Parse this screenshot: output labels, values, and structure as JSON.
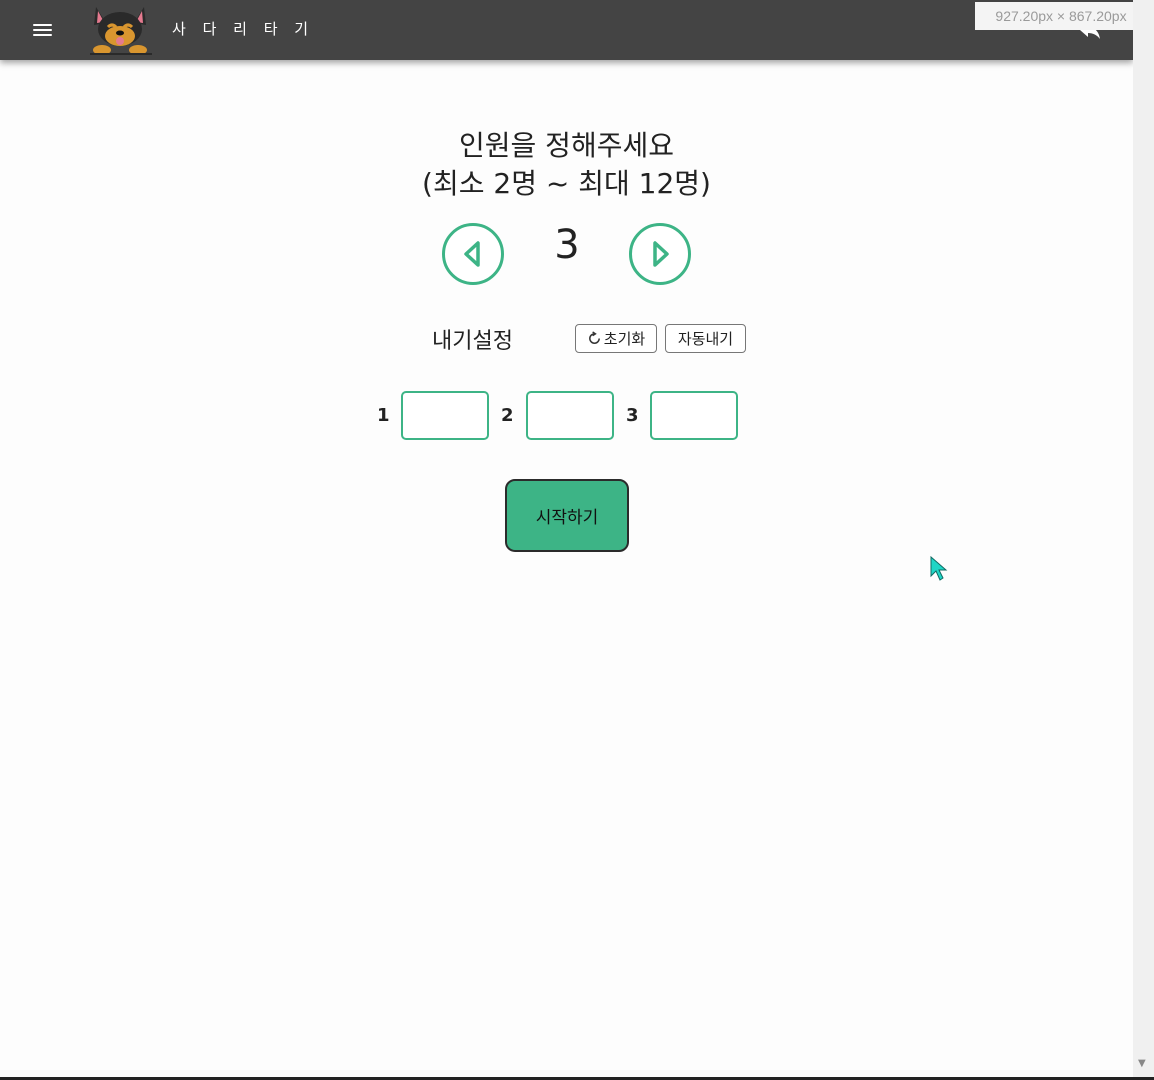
{
  "header": {
    "app_title": "사 다 리 타 기",
    "menu_icon": "hamburger-menu-icon",
    "logo_icon": "dog-mascot-logo",
    "share_icon": "share-icon",
    "background": "#444444"
  },
  "overlay": {
    "dimensions": "927.20px × 867.20px"
  },
  "main": {
    "title_line1": "인원을 정해주세요",
    "title_line2": "(최소 2명 ~ 최대 12명)",
    "player_count": "3",
    "prev_icon": "triangle-left-icon",
    "next_icon": "triangle-right-icon",
    "bet_label": "내기설정",
    "reset_label": "초기화",
    "reset_icon": "refresh-icon",
    "auto_label": "자동내기",
    "players": [
      {
        "number": "1",
        "value": ""
      },
      {
        "number": "2",
        "value": ""
      },
      {
        "number": "3",
        "value": ""
      }
    ],
    "start_label": "시작하기"
  },
  "colors": {
    "accent": "#3db486",
    "header": "#444444",
    "text": "#222222"
  }
}
